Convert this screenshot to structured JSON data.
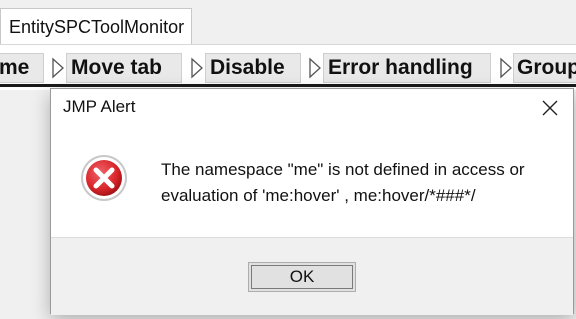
{
  "window": {
    "tab_label": "EntitySPCToolMonitor"
  },
  "toolbar": {
    "buttons": [
      {
        "label": "me",
        "icon": "play-arrow-icon"
      },
      {
        "label": "Move tab",
        "icon": "play-arrow-icon"
      },
      {
        "label": "Disable",
        "icon": "play-arrow-icon"
      },
      {
        "label": "Error handling",
        "icon": "play-arrow-icon"
      },
      {
        "label": "Group",
        "icon": "play-arrow-icon"
      }
    ]
  },
  "dialog": {
    "title": "JMP Alert",
    "close_icon": "close-icon",
    "error_icon": "error-icon",
    "message_line1": "The namespace \"me\" is not defined in access or",
    "message_line2": "evaluation of 'me:hover' , me:hover/*###*/",
    "ok_label": "OK"
  },
  "colors": {
    "error_red": "#d9262b",
    "dialog_bg": "#ffffff",
    "footer_bg": "#f0f0f0"
  }
}
